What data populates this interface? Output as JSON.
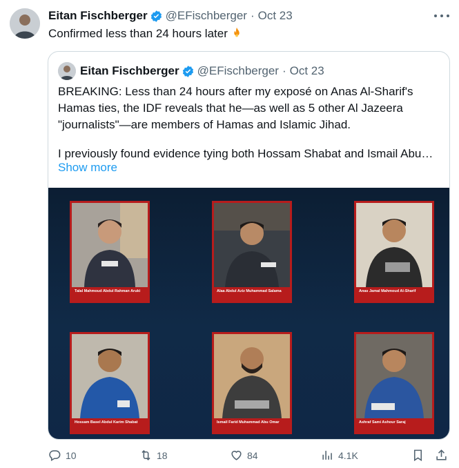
{
  "tweet": {
    "author_name": "Eitan Fischberger",
    "handle": "@EFischberger",
    "separator": "·",
    "date": "Oct 23",
    "text": "Confirmed less than 24 hours later"
  },
  "quoted": {
    "author_name": "Eitan Fischberger",
    "handle": "@EFischberger",
    "separator": "·",
    "date": "Oct 23",
    "paragraph1": "BREAKING: Less than 24 hours after my exposé on Anas Al-Sharif's Hamas ties, the IDF reveals that he—as well as 5 other Al Jazeera \"journalists\"—are members of Hamas and Islamic Jihad.",
    "paragraph2": "I previously found evidence tying both Hossam Shabat and Ismail Abu…",
    "show_more": "Show more",
    "media_cards": [
      {
        "caption": "Talal Mahmoud Abdul Rahman Aruki"
      },
      {
        "caption": "Alaa Abdul Aziz Muhammad Salama"
      },
      {
        "caption": "Anas Jamal Mahmoud Al-Sharif"
      },
      {
        "caption": "Hossam Basel Abdul Karim Shabat"
      },
      {
        "caption": "Ismail Farid Muhammad Abu Omar"
      },
      {
        "caption": "Ashraf Sami Ashour Saraj"
      }
    ]
  },
  "actions": {
    "replies": "10",
    "reposts": "18",
    "likes": "84",
    "views": "4.1K"
  },
  "colors": {
    "accent": "#1d9bf0",
    "secondary_text": "#536471",
    "card_border": "#b71c1c",
    "media_background": "#0f2746"
  }
}
